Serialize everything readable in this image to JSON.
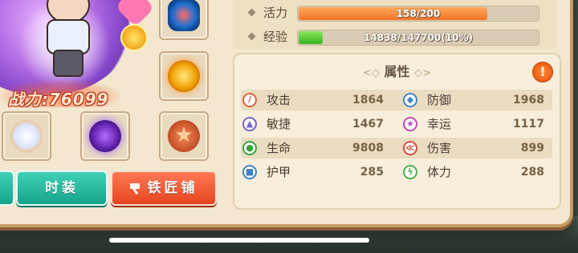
{
  "character": {
    "power_label": "战力:76099"
  },
  "stats": {
    "energy": {
      "label": "活力",
      "text": "158/200",
      "fraction": 0.79
    },
    "exp": {
      "label": "经验",
      "text": "14838/147700(10%)",
      "fraction": 0.1
    }
  },
  "attributes": {
    "title": "属性",
    "warning_symbol": "!",
    "left": [
      {
        "name": "攻击",
        "value": "1864",
        "color": "#e2643c",
        "icon": "sword-icon"
      },
      {
        "name": "敏捷",
        "value": "1467",
        "color": "#7a63c9",
        "icon": "wing-icon"
      },
      {
        "name": "生命",
        "value": "9808",
        "color": "#38a33c",
        "icon": "drop-icon"
      },
      {
        "name": "护甲",
        "value": "285",
        "color": "#3f84c8",
        "icon": "armor-icon"
      }
    ],
    "right": [
      {
        "name": "防御",
        "value": "1968",
        "color": "#3f84c8",
        "icon": "shield-icon"
      },
      {
        "name": "幸运",
        "value": "1117",
        "color": "#c44bb4",
        "icon": "star-icon"
      },
      {
        "name": "伤害",
        "value": "899",
        "color": "#d94a3a",
        "icon": "claw-icon"
      },
      {
        "name": "体力",
        "value": "288",
        "color": "#4ab04a",
        "icon": "bolt-icon"
      }
    ]
  },
  "buttons": {
    "fashion": "时装",
    "blacksmith": "铁匠铺"
  },
  "colors": {
    "panel_bg": "#f3e7cf",
    "frame_border": "#c89a63",
    "teal_button": "#16a48c",
    "orange_button": "#e7441f"
  }
}
